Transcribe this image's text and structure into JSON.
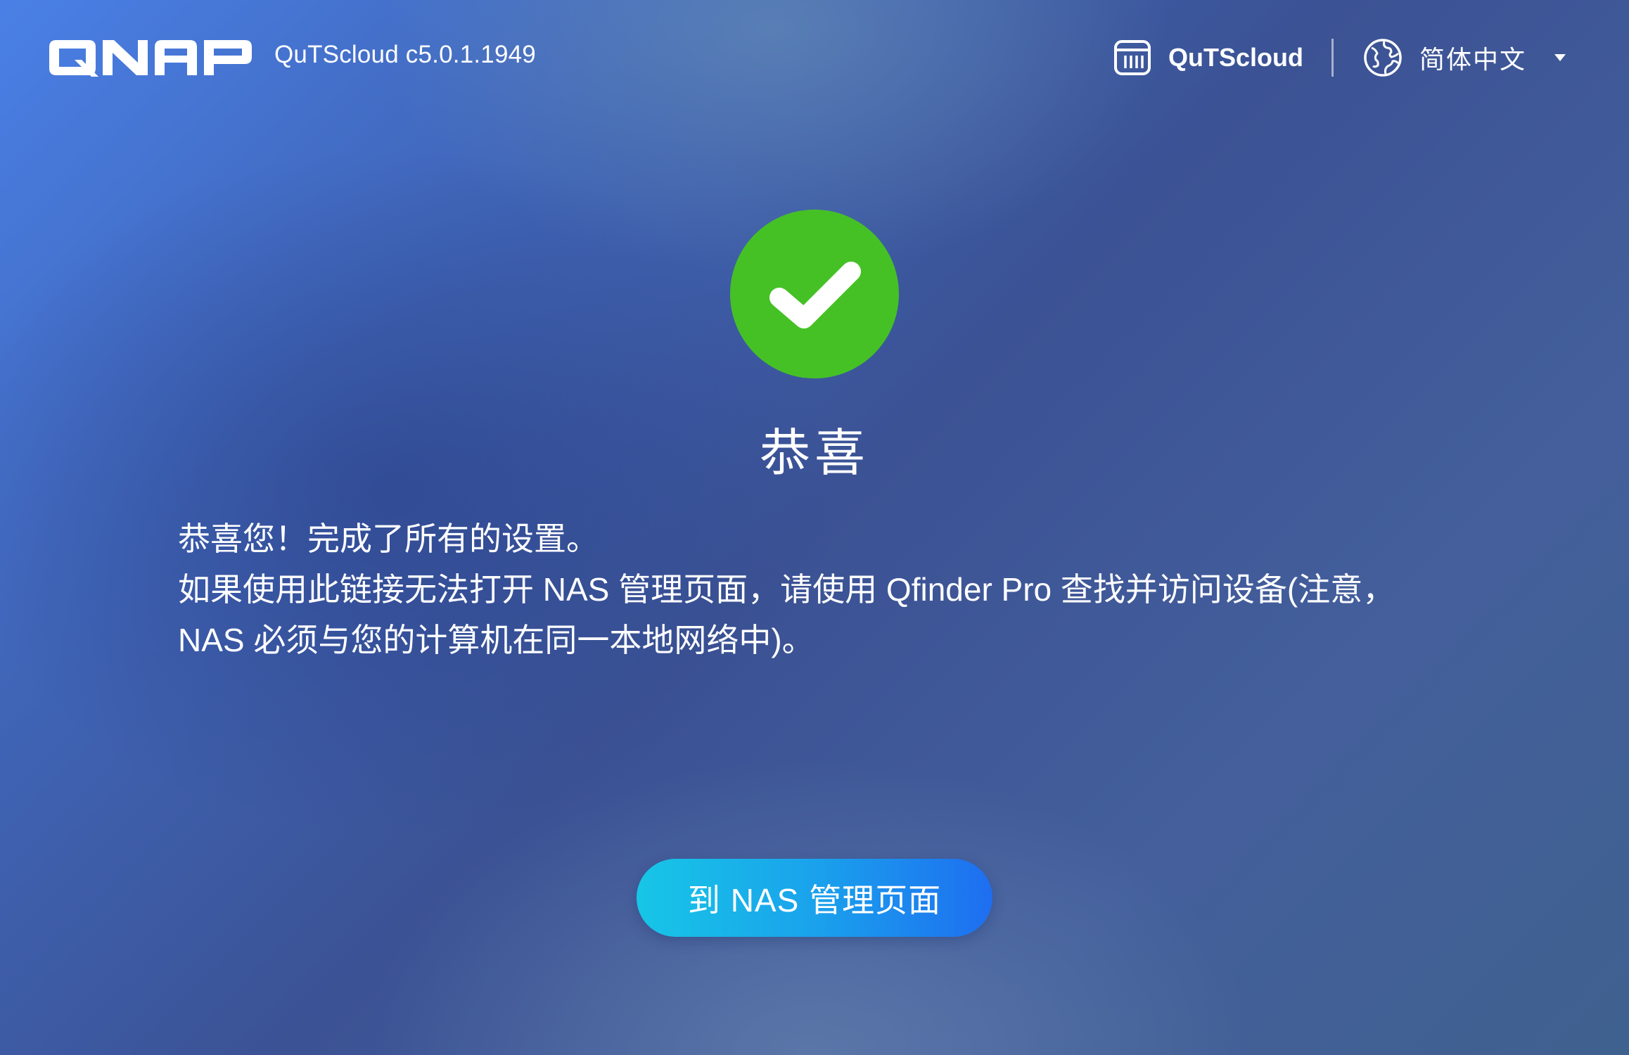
{
  "header": {
    "brand": "QNAP",
    "version": "QuTScloud c5.0.1.1949",
    "app_name": "QuTScloud",
    "language": "简体中文"
  },
  "main": {
    "title": "恭喜",
    "message_lines": [
      "恭喜您！完成了所有的设置。",
      "如果使用此链接无法打开 NAS 管理页面，请使用 Qfinder Pro 查找并访问设备(注意，",
      "NAS 必须与您的计算机在同一本地网络中)。"
    ],
    "button_label": "到 NAS 管理页面"
  },
  "colors": {
    "success_green": "#45c126",
    "button_gradient_start": "#17c6e6",
    "button_gradient_end": "#1e6ef0"
  },
  "icons": {
    "app": "qutscloud-app-icon",
    "language": "globe-icon",
    "dropdown": "caret-down-icon",
    "status": "checkmark-icon"
  }
}
